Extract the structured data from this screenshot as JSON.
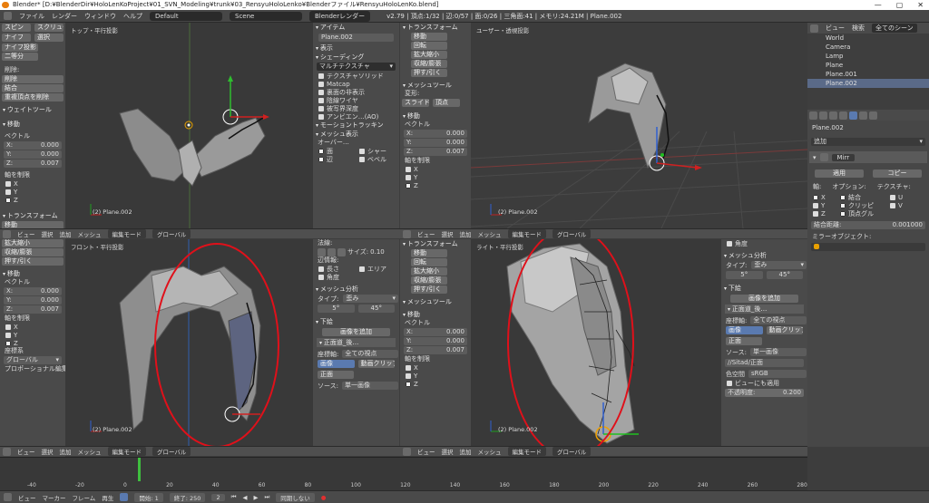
{
  "title": "Blender* [D:¥BlenderDir¥HoloLenKoProject¥01_SVN_Modeling¥trunk¥03_RensyuHoloLenko¥Blenderファイル¥RensyuHoloLenKo.blend]",
  "window_controls": [
    "—",
    "▢",
    "✕"
  ],
  "menubar": {
    "items": [
      "ファイル",
      "レンダー",
      "ウィンドウ",
      "ヘルプ"
    ],
    "layout": "Default",
    "scene": "Scene",
    "engine": "Blenderレンダー",
    "info": "v2.79 | 頂点:1/32 | 辺:0/57 | 面:0/26 | 三角面:41 | メモリ:24.21M | Plane.002"
  },
  "left_tools": {
    "buttons_top": [
      "スピン",
      "スクリュー",
      "ナイフ",
      "選択",
      "ナイフ投影",
      "二等分"
    ],
    "delete_label": "削除:",
    "delete_buttons": [
      "削除",
      "結合",
      "重複頂点を削除"
    ],
    "weight_tools": "ウェイトツール",
    "move_header": "移動",
    "vector_label": "ベクトル",
    "axis_constraint": "軸を制限"
  },
  "viewports": {
    "top_left": {
      "label": "トップ・平行投影",
      "object": "(2) Plane.002"
    },
    "top_right": {
      "label": "ユーザー・透視投影",
      "object": "(2) Plane.002"
    },
    "bottom_left": {
      "label": "フロント・平行投影",
      "object": "(2) Plane.002"
    },
    "bottom_right": {
      "label": "ライト・平行投影",
      "object": "(2) Plane.002"
    }
  },
  "n_panel_top": {
    "item_header": "アイテム",
    "object_name": "Plane.002",
    "display_header": "表示",
    "shading_header": "シェーディング",
    "shading_mode": "マルチテクスチャ",
    "options": [
      "テクスチャソリッド",
      "Matcap",
      "裏面の非表示",
      "陰線ワイヤ",
      "被写界深度",
      "アンビエン…(AO)"
    ],
    "motion_tracking": "モーショントラッキン",
    "mesh_display": "メッシュ表示",
    "overlay": "オーバー…",
    "overlay_items": [
      "面",
      "シャー",
      "辺",
      "ベベル"
    ]
  },
  "transform_panel": {
    "header": "トランスフォーム",
    "buttons": [
      "移動",
      "回転",
      "拡大縮小",
      "収縮/膨張",
      "押す/引く"
    ],
    "mesh_tools": "メッシュツール",
    "deform": "変形:",
    "deform_btns": [
      "スライド",
      "頂点"
    ],
    "move_header": "移動",
    "vector": "ベクトル",
    "x": "X:",
    "y": "Y:",
    "z": "Z:",
    "val": "0.000",
    "val_short": "0.007",
    "axis_constraint": "軸を制限",
    "axes": [
      "X",
      "Y",
      "Z"
    ],
    "orientation": "座標系",
    "orientation_value": "グローバル",
    "proportional": "プロポーショナル編集"
  },
  "bottom_n_panel": {
    "normals": "法線:",
    "size_label": "サイズ:",
    "size_val": "0.10",
    "edge_info": "辺情報:",
    "edge_info_items": [
      "長さ",
      "エリア",
      "角度"
    ],
    "angle": "角度",
    "mesh_analysis": "メッシュ分析",
    "type_label": "タイプ:",
    "type_val": "歪み",
    "range_min": "5°",
    "range_max": "45°",
    "lower": "下絵",
    "add_image": "画像を追加",
    "front_ortho": "正面道_後…",
    "coordinate": "座標軸:",
    "coordinate_val": "全ての視点",
    "image_btn": "画像",
    "movie_btn": "動画クリップ",
    "front_btn": "正面",
    "source": "ソース:",
    "source_val": "単一画像",
    "file_val": "//Sitad/正面",
    "color_space": "色空間",
    "color_space_val": "sRGB",
    "view_as_render": "ビューにも適用",
    "opacity": "不透明度:",
    "opacity_val": "0.200"
  },
  "vheader": {
    "items": [
      "ビュー",
      "選択",
      "追加",
      "メッシュ"
    ],
    "mode": "編集モード",
    "global": "グローバル"
  },
  "outliner": {
    "view": "ビュー",
    "search": "検索",
    "scene_filter": "全てのシーン",
    "rows": [
      "World",
      "Camera",
      "Lamp",
      "Plane",
      "Plane.001",
      "Plane.002"
    ]
  },
  "properties": {
    "object": "Plane.002",
    "add": "追加",
    "modifier_name": "Mirr",
    "apply": "適用",
    "copy": "コピー",
    "axis_label": "軸:",
    "options_label": "オプション:",
    "texture_label": "テクスチャ:",
    "x": "X",
    "y": "Y",
    "z": "Z",
    "merge": "結合",
    "clipping": "クリッピ",
    "vertex_group": "頂点グル",
    "u": "U",
    "v": "V",
    "merge_limit": "結合距離:",
    "merge_limit_val": "0.001000",
    "mirror_object": "ミラーオブジェクト:"
  },
  "timeline": {
    "ticks": [
      "-40",
      "-20",
      "0",
      "20",
      "40",
      "60",
      "80",
      "100",
      "120",
      "140",
      "160",
      "180",
      "200",
      "220",
      "240",
      "260",
      "280"
    ],
    "menu": [
      "ビュー",
      "マーカー",
      "フレーム",
      "再生"
    ],
    "start_label": "開始:",
    "start": "1",
    "end_label": "終了:",
    "end": "250",
    "current": "2",
    "sync": "同期しない"
  }
}
